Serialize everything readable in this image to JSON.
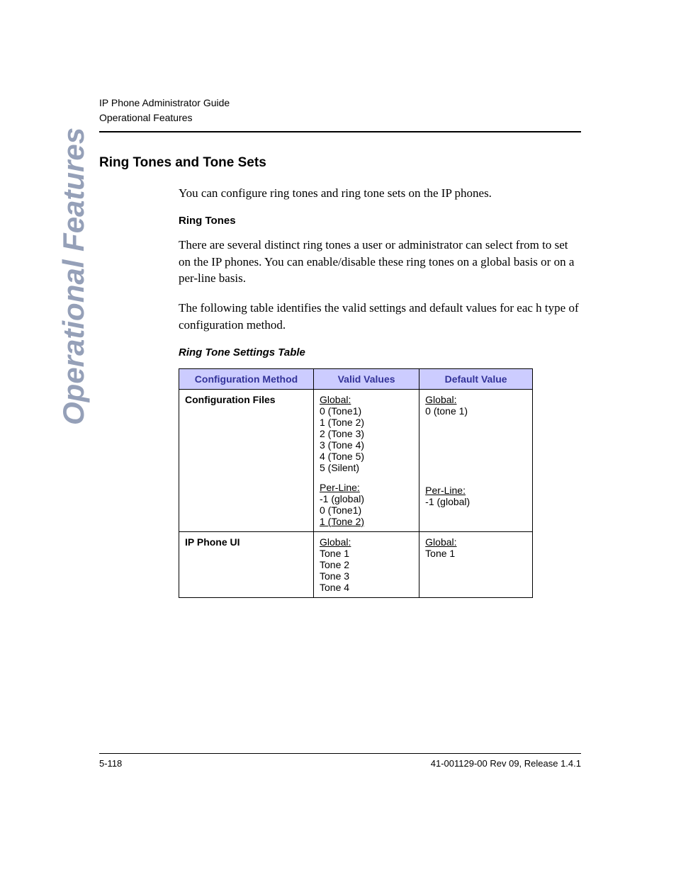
{
  "header": {
    "line1": "IP Phone Administrator Guide",
    "line2": "Operational Features"
  },
  "sidebar": "Operational Features",
  "section_title": "Ring Tones and Tone Sets",
  "intro_para": "You can configure ring tones and ring tone sets on the IP phones.",
  "ring_tones_head": "Ring Tones",
  "ring_tones_para1": "There are several distinct ring tones a user or administrator can select from to set on the IP phones. You can enable/disable these ring tones on a global basis or on a per-line basis.",
  "ring_tones_para2": "The following table identifies the valid settings and default values for eac h type of configuration method.",
  "table_title": "Ring Tone Settings Table",
  "table": {
    "headers": [
      "Configuration Method",
      "Valid Values",
      "Default Value"
    ],
    "rows": [
      {
        "method": "Configuration Files",
        "valid": {
          "global_label": "Global:",
          "global_lines": [
            "0 (Tone1)",
            "1 (Tone 2)",
            "2 (Tone 3)",
            "3 (Tone 4)",
            "4 (Tone 5)",
            "5 (Silent)"
          ],
          "perline_label": "Per-Line:",
          "perline_lines": [
            "-1 (global)",
            "0 (Tone1)",
            "1 (Tone 2)"
          ]
        },
        "default": {
          "global_label": "Global:",
          "global_lines": [
            "0 (tone 1)"
          ],
          "perline_label": "Per-Line:",
          "perline_lines": [
            "-1 (global)"
          ]
        }
      },
      {
        "method": "IP Phone UI",
        "valid": {
          "global_label": "Global:",
          "global_lines": [
            "Tone 1",
            "Tone 2",
            "Tone 3",
            "Tone 4"
          ]
        },
        "default": {
          "global_label": "Global:",
          "global_lines": [
            "Tone 1"
          ]
        }
      }
    ]
  },
  "footer": {
    "page_num": "5-118",
    "doc_id": "41-001129-00 Rev 09, Release 1.4.1"
  }
}
